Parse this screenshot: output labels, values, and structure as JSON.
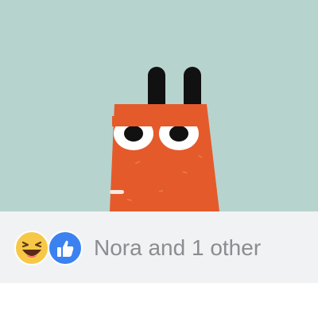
{
  "post": {
    "media": {
      "background_color": "#b7d3ce",
      "character_color": "#e55a2b"
    },
    "reactions": {
      "icons": [
        "haha-reaction-icon",
        "like-reaction-icon"
      ],
      "summary": "Nora and 1 other"
    }
  }
}
